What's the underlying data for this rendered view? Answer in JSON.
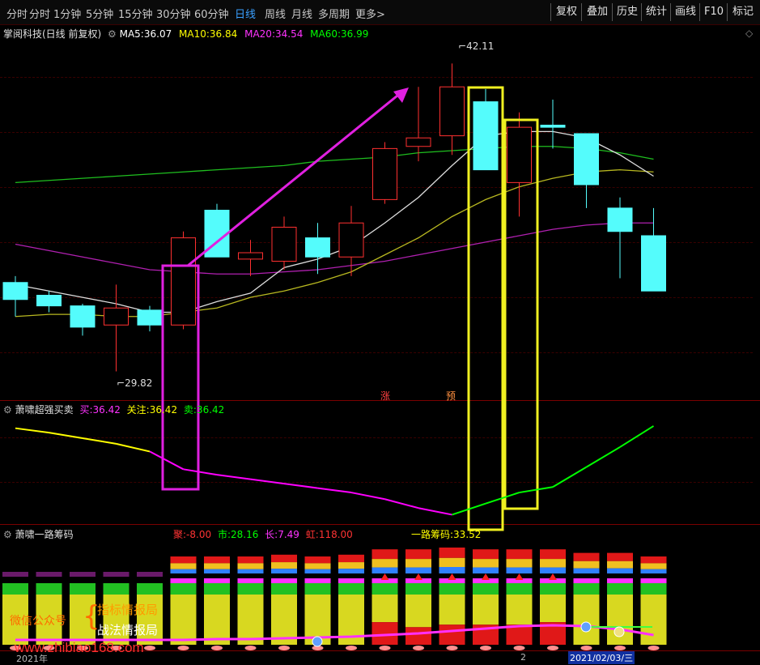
{
  "toolbar": {
    "tabs": [
      "分时",
      "1分钟",
      "5分钟",
      "15分钟",
      "30分钟",
      "60分钟",
      "日线",
      "周线",
      "月线",
      "多周期",
      "更多>"
    ],
    "active_tab": "日线",
    "buttons": [
      "复权",
      "叠加",
      "历史",
      "统计",
      "画线",
      "F10",
      "标记"
    ]
  },
  "main_legend": {
    "name": "掌阅科技(日线 前复权)",
    "ma5_label": "MA5:",
    "ma5": "36.07",
    "ma10_label": "MA10:",
    "ma10": "36.84",
    "ma20_label": "MA20:",
    "ma20": "34.54",
    "ma60_label": "MA60:",
    "ma60": "36.99",
    "colors": {
      "ma5": "#ffffff",
      "ma10": "#ffff00",
      "ma20": "#ff00ff",
      "ma60": "#00ff00"
    }
  },
  "price_labels": {
    "high": "42.11",
    "low": "29.82"
  },
  "markers": {
    "zhang": "涨",
    "yu": "预"
  },
  "panel2": {
    "title": "萧啸超强买卖",
    "buy_label": "买:",
    "buy": "36.42",
    "watch_label": "关注:",
    "watch": "36.42",
    "sell_label": "卖:",
    "sell": "36.42"
  },
  "panel3": {
    "title": "萧啸一路筹码",
    "main_label": "聚:",
    "main_val": "-8.00",
    "market_label": "市:",
    "market_val": "28.16",
    "long_label": "长:",
    "long_val": "7.49",
    "short_label": "虹:",
    "short_val": "118.00",
    "chip_label": "一路筹码:",
    "chip_val": "33.52"
  },
  "watermark": {
    "left": "微信公众号",
    "line1": "指标情报局",
    "line2": "战法情报局",
    "url": "www.zhibiao168.com"
  },
  "bottom_axis": {
    "year": "2021年",
    "month_mark": "2",
    "date": "2021/02/03/三"
  },
  "chart_data": {
    "type": "candlestick",
    "candles": [
      {
        "o": 34.0,
        "c": 33.2,
        "h": 34.3,
        "l": 32.4
      },
      {
        "o": 33.4,
        "c": 32.9,
        "h": 33.6,
        "l": 32.6
      },
      {
        "o": 32.9,
        "c": 31.9,
        "h": 33.0,
        "l": 31.5
      },
      {
        "o": 32.0,
        "c": 32.8,
        "h": 33.9,
        "l": 29.82
      },
      {
        "o": 32.7,
        "c": 32.0,
        "h": 32.9,
        "l": 31.7
      },
      {
        "o": 32.0,
        "c": 36.1,
        "h": 36.4,
        "l": 31.8
      },
      {
        "o": 37.4,
        "c": 35.2,
        "h": 37.7,
        "l": 35.2
      },
      {
        "o": 35.1,
        "c": 35.4,
        "h": 36.0,
        "l": 34.3
      },
      {
        "o": 35.0,
        "c": 36.6,
        "h": 37.1,
        "l": 34.6
      },
      {
        "o": 36.1,
        "c": 35.2,
        "h": 36.8,
        "l": 34.4
      },
      {
        "o": 35.2,
        "c": 36.8,
        "h": 37.6,
        "l": 34.3
      },
      {
        "o": 37.9,
        "c": 40.3,
        "h": 40.6,
        "l": 37.7
      },
      {
        "o": 40.4,
        "c": 40.8,
        "h": 43.2,
        "l": 39.7
      },
      {
        "o": 40.9,
        "c": 43.2,
        "h": 44.3,
        "l": 40.0
      },
      {
        "o": 42.5,
        "c": 39.3,
        "h": 43.1,
        "l": 39.3
      },
      {
        "o": 38.7,
        "c": 41.3,
        "h": 42.0,
        "l": 37.1
      },
      {
        "o": 41.4,
        "c": 41.3,
        "h": 42.6,
        "l": 40.3
      },
      {
        "o": 41.0,
        "c": 38.6,
        "h": 41.0,
        "l": 37.5
      },
      {
        "o": 37.5,
        "c": 36.4,
        "h": 38.0,
        "l": 34.2
      },
      {
        "o": 36.2,
        "c": 33.6,
        "h": 37.5,
        "l": 33.6
      }
    ],
    "ma5": [
      33.9,
      33.6,
      33.3,
      33.0,
      32.6,
      32.6,
      33.1,
      33.5,
      34.7,
      35.1,
      35.7,
      36.8,
      38.0,
      39.5,
      40.9,
      41.1,
      41.1,
      40.8,
      40.0,
      39.0
    ],
    "ma10": [
      32.4,
      32.5,
      32.5,
      32.4,
      32.4,
      32.6,
      32.8,
      33.3,
      33.6,
      34.0,
      34.5,
      35.3,
      36.1,
      37.1,
      37.9,
      38.5,
      38.9,
      39.2,
      39.3,
      39.2
    ],
    "ma20": [
      35.8,
      35.5,
      35.2,
      34.9,
      34.6,
      34.5,
      34.4,
      34.4,
      34.5,
      34.6,
      34.8,
      35.0,
      35.3,
      35.6,
      35.9,
      36.2,
      36.5,
      36.7,
      36.8,
      36.8
    ],
    "ma60": [
      38.7,
      38.8,
      38.9,
      39.0,
      39.1,
      39.2,
      39.3,
      39.4,
      39.5,
      39.7,
      39.8,
      39.9,
      40.1,
      40.2,
      40.3,
      40.4,
      40.4,
      40.3,
      40.1,
      39.8
    ],
    "ylim": [
      29.0,
      45.0
    ],
    "indicator_line": [
      {
        "v": 36.0,
        "color": "#ffff00"
      },
      {
        "v": 35.6,
        "color": "#ffff00"
      },
      {
        "v": 35.1,
        "color": "#ffff00"
      },
      {
        "v": 34.6,
        "color": "#ffff00"
      },
      {
        "v": 33.9,
        "color": "#ffff00"
      },
      {
        "v": 32.3,
        "color": "#ff00ff"
      },
      {
        "v": 31.8,
        "color": "#ff00ff"
      },
      {
        "v": 31.4,
        "color": "#ff00ff"
      },
      {
        "v": 31.0,
        "color": "#ff00ff"
      },
      {
        "v": 30.6,
        "color": "#ff00ff"
      },
      {
        "v": 30.2,
        "color": "#ff00ff"
      },
      {
        "v": 29.6,
        "color": "#ff00ff"
      },
      {
        "v": 28.8,
        "color": "#ff00ff"
      },
      {
        "v": 28.2,
        "color": "#ff00ff"
      },
      {
        "v": 29.2,
        "color": "#00ff00"
      },
      {
        "v": 30.2,
        "color": "#00ff00"
      },
      {
        "v": 30.7,
        "color": "#00ff00"
      },
      {
        "v": 32.5,
        "color": "#00ff00"
      },
      {
        "v": 34.3,
        "color": "#00ff00"
      },
      {
        "v": 36.2,
        "color": "#00ff00"
      }
    ],
    "chip_red_fraction": [
      0,
      0,
      0,
      0,
      0,
      0,
      0,
      0,
      0,
      0,
      0,
      0.45,
      0.35,
      0.4,
      0.4,
      0.4,
      0.45,
      0,
      0,
      0
    ],
    "chip_caps": [
      0,
      0,
      0,
      0,
      0,
      0.5,
      0.5,
      0.5,
      0.6,
      0.5,
      0.6,
      0.9,
      0.9,
      1.0,
      0.9,
      0.9,
      0.9,
      0.7,
      0.7,
      0.5
    ]
  }
}
